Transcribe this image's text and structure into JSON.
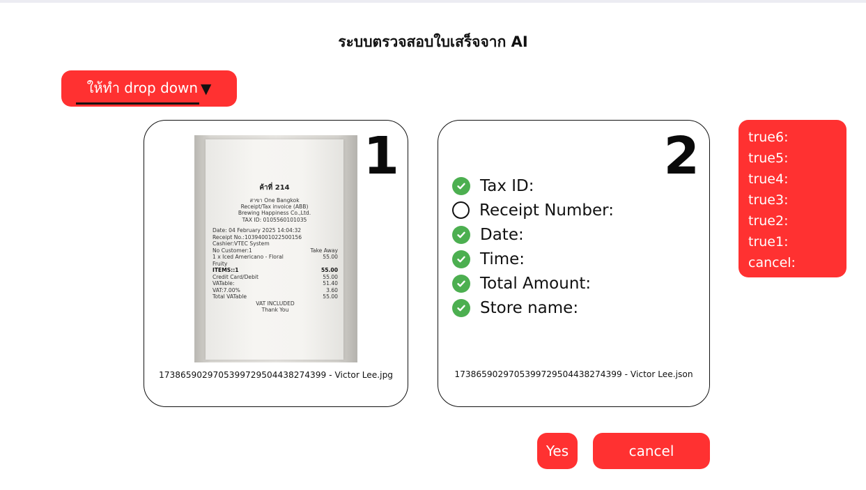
{
  "page": {
    "title": "ระบบตรวจสอบใบเสร็จจาก AI"
  },
  "dropdown": {
    "label": "ให้ทำ drop down",
    "caret": "▼"
  },
  "image_card": {
    "number": "1",
    "filename": "1738659029705399729504438274399 - Victor Lee.jpg",
    "receipt": {
      "table": "ค้าที่ 214",
      "header_lines": [
        "สาขา One Bangkok",
        "Receipt/Tax invoice (ABB)",
        "Brewing Happiness Co.,Ltd.",
        "TAX ID: 0105560101035"
      ],
      "date": "Date: 04 February 2025 14:04:32",
      "receipt_no": "Receipt No.:10394001022500156",
      "cashier": "Cashier:VTEC System",
      "customers": "No Customer:1",
      "take_away": "Take Away",
      "item": "1 x Iced Americano - Floral",
      "item_price": "55.00",
      "item_note": "Fruity",
      "items_label": "ITEMS::1",
      "items_total": "55.00",
      "lines": [
        {
          "label": "Credit Card/Debit",
          "value": "55.00"
        },
        {
          "label": "VATable:",
          "value": "51.40"
        },
        {
          "label": "VAT:7.00%",
          "value": "3.60"
        },
        {
          "label": "Total VATable",
          "value": "55.00"
        }
      ],
      "vat_included": "VAT INCLUDED",
      "thanks": "Thank You"
    }
  },
  "result_card": {
    "number": "2",
    "filename": "1738659029705399729504438274399 - Victor Lee.json",
    "fields": [
      {
        "label": "Tax ID:",
        "status": "done",
        "icon": "check-circle-icon"
      },
      {
        "label": "Receipt Number:",
        "status": "pending",
        "icon": "empty-circle-icon"
      },
      {
        "label": "Date:",
        "status": "done",
        "icon": "check-circle-icon"
      },
      {
        "label": "Time:",
        "status": "done",
        "icon": "check-circle-icon"
      },
      {
        "label": "Total Amount:",
        "status": "done",
        "icon": "check-circle-icon"
      },
      {
        "label": "Store name:",
        "status": "done",
        "icon": "check-circle-icon"
      }
    ]
  },
  "side_panel": {
    "items": [
      "true6:",
      "true5:",
      "true4:",
      "true3:",
      "true2:",
      "true1:",
      "cancel:"
    ]
  },
  "actions": {
    "yes_label": "Yes",
    "cancel_label": "cancel"
  },
  "colors": {
    "accent": "#ff3131",
    "check": "#4caf50"
  }
}
